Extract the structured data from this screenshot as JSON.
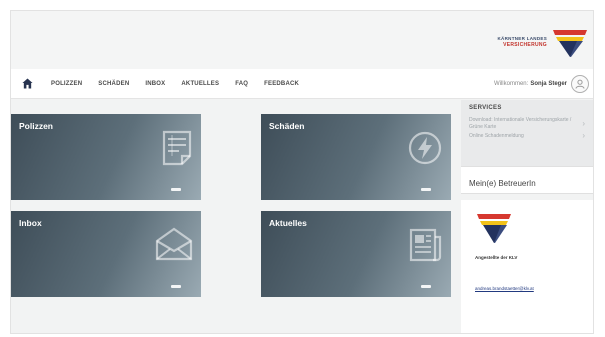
{
  "header": {
    "logo_line1": "KÄRNTNER LANDES",
    "logo_line2": "VERSICHERUNG"
  },
  "nav": {
    "items": [
      {
        "label": "POLIZZEN"
      },
      {
        "label": "SCHÄDEN"
      },
      {
        "label": "INBOX"
      },
      {
        "label": "AKTUELLES"
      },
      {
        "label": "FAQ"
      },
      {
        "label": "FEEDBACK"
      }
    ],
    "welcome_prefix": "Willkommen:",
    "user_name": "Sonja Steger"
  },
  "tiles": [
    {
      "title": "Polizzen",
      "icon": "document-list-icon"
    },
    {
      "title": "Schäden",
      "icon": "lightning-bolt-icon"
    },
    {
      "title": "Inbox",
      "icon": "envelope-icon"
    },
    {
      "title": "Aktuelles",
      "icon": "newspaper-icon"
    }
  ],
  "services": {
    "title": "SERVICES",
    "links": [
      {
        "label": "Download: Internationale Versicherungskarte / Grüne Karte"
      },
      {
        "label": "Online Schadenmeldung"
      }
    ]
  },
  "betreuer": {
    "title": "Mein(e) BetreuerIn"
  },
  "contact": {
    "label": "Angestellte der KLV",
    "email": "andreas.brandstaetter@klv.at"
  },
  "colors": {
    "brand_red": "#d6382f",
    "brand_yellow": "#f2c21a",
    "brand_navy": "#23325e",
    "tile_dark": "#3e4d58"
  }
}
